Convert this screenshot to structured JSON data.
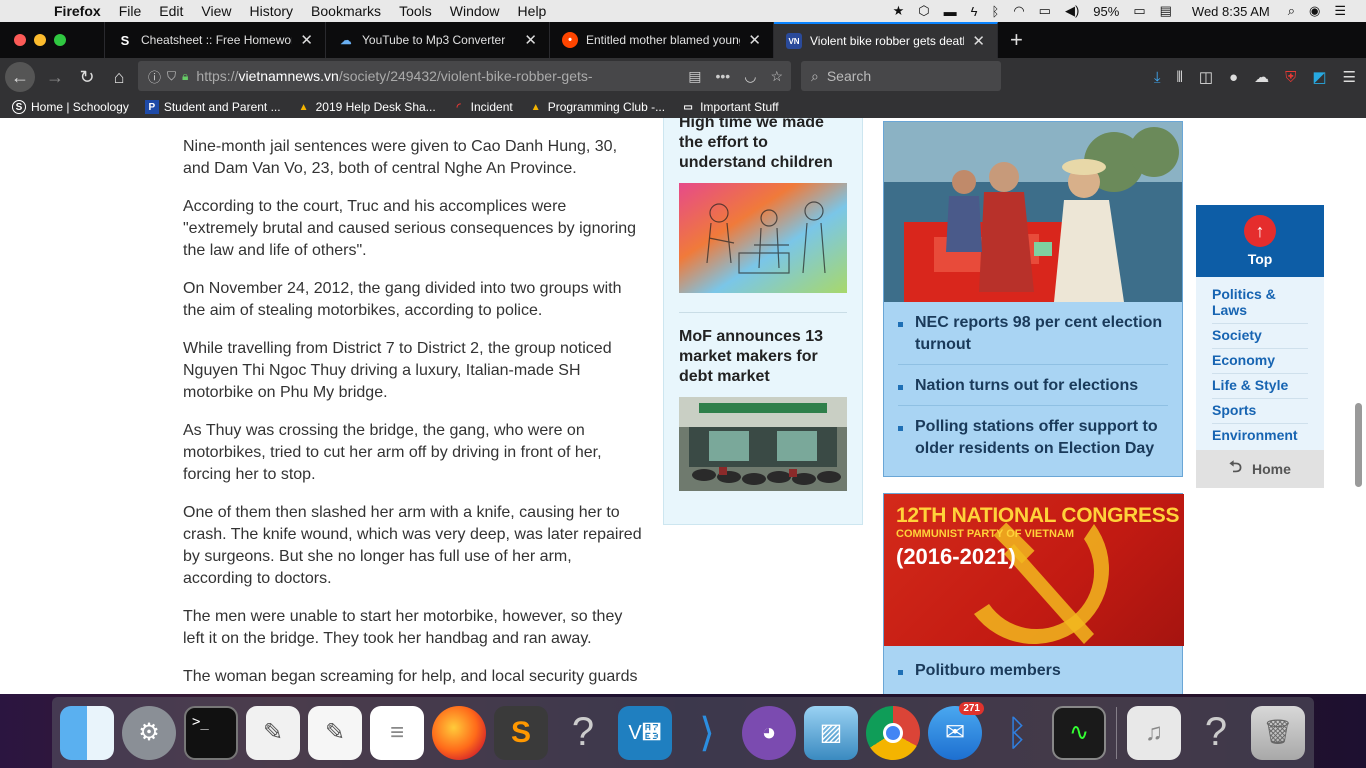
{
  "menubar": {
    "app": "Firefox",
    "items": [
      "File",
      "Edit",
      "View",
      "History",
      "Bookmarks",
      "Tools",
      "Window",
      "Help"
    ],
    "battery": "95%",
    "clock": "Wed 8:35 AM"
  },
  "tabs": [
    {
      "title": "Cheatsheet :: Free Homework H",
      "favicon": "S"
    },
    {
      "title": "YouTube to Mp3 Converter",
      "favicon": "yt"
    },
    {
      "title": "Entitled mother blamed young",
      "favicon": "reddit"
    },
    {
      "title": "Violent bike robber gets death",
      "favicon": "vn"
    }
  ],
  "urlbar": {
    "prefix": "https://",
    "domain": "vietnamnews.vn",
    "path": "/society/249432/violent-bike-robber-gets-"
  },
  "search": {
    "placeholder": "Search"
  },
  "bookmarks": [
    {
      "label": "Home | Schoology",
      "icon": "S"
    },
    {
      "label": "Student and Parent ...",
      "icon": "P"
    },
    {
      "label": "2019 Help Desk Sha...",
      "icon": "drive"
    },
    {
      "label": "Incident",
      "icon": "ring"
    },
    {
      "label": "Programming Club -...",
      "icon": "drive"
    },
    {
      "label": "Important Stuff",
      "icon": "folder"
    }
  ],
  "article": {
    "paragraphs": [
      "Nine-month jail sentences were given to Cao Danh Hung, 30, and Dam Van Vo, 23, both of central Nghe An Province.",
      "According to the court, Truc and his accomplices were \"extremely brutal and caused serious consequences by ignoring the law and life of others\".",
      "On November 24, 2012, the gang divided into two groups with the aim of stealing motorbikes, according to police.",
      "While travelling from District 7 to District 2, the group noticed Nguyen Thi Ngoc Thuy driving a luxury, Italian-made SH motorbike on Phu My bridge.",
      "As Thuy was crossing the bridge, the gang, who were on motorbikes, tried to cut her arm off by driving in front of her, forcing her to stop.",
      "One of them then slashed her arm with a knife, causing her to crash. The knife wound, which was very deep, was later repaired by surgeons. But she no longer has full use of her arm, according to doctors.",
      "The men were unable to start her motorbike, however, so they left it on the bridge. They took her handbag and ran away.",
      "The woman began screaming for help, and local security guards"
    ]
  },
  "middle": [
    {
      "title": "High time we made the effort to understand children"
    },
    {
      "title": "MoF announces 13 market makers for debt market"
    }
  ],
  "election": {
    "items": [
      "NEC reports 98 per cent election turnout",
      "Nation turns out for elections",
      "Polling stations offer support to older residents on Election Day"
    ]
  },
  "congress": {
    "line1": "12TH NATIONAL CONGRESS",
    "line2": "COMMUNIST PARTY OF VIETNAM",
    "line3": "(2016-2021)",
    "items": [
      "Politburo members"
    ]
  },
  "floatnav": {
    "top": "Top",
    "items": [
      "Politics & Laws",
      "Society",
      "Economy",
      "Life & Style",
      "Sports",
      "Environment"
    ],
    "home": "Home"
  },
  "dock": {
    "mail_badge": "271",
    "apps": [
      "Finder",
      "System Preferences",
      "Terminal",
      "Script Editor",
      "TextEdit",
      "Notes",
      "Firefox",
      "Sublime Text",
      "Unknown",
      "VNC Viewer",
      "Visual Studio Code",
      "GitHub Desktop",
      "Preview",
      "Chrome",
      "Mail",
      "Bluetooth",
      "Activity Monitor",
      "iTunes",
      "Unknown",
      "Trash"
    ]
  }
}
